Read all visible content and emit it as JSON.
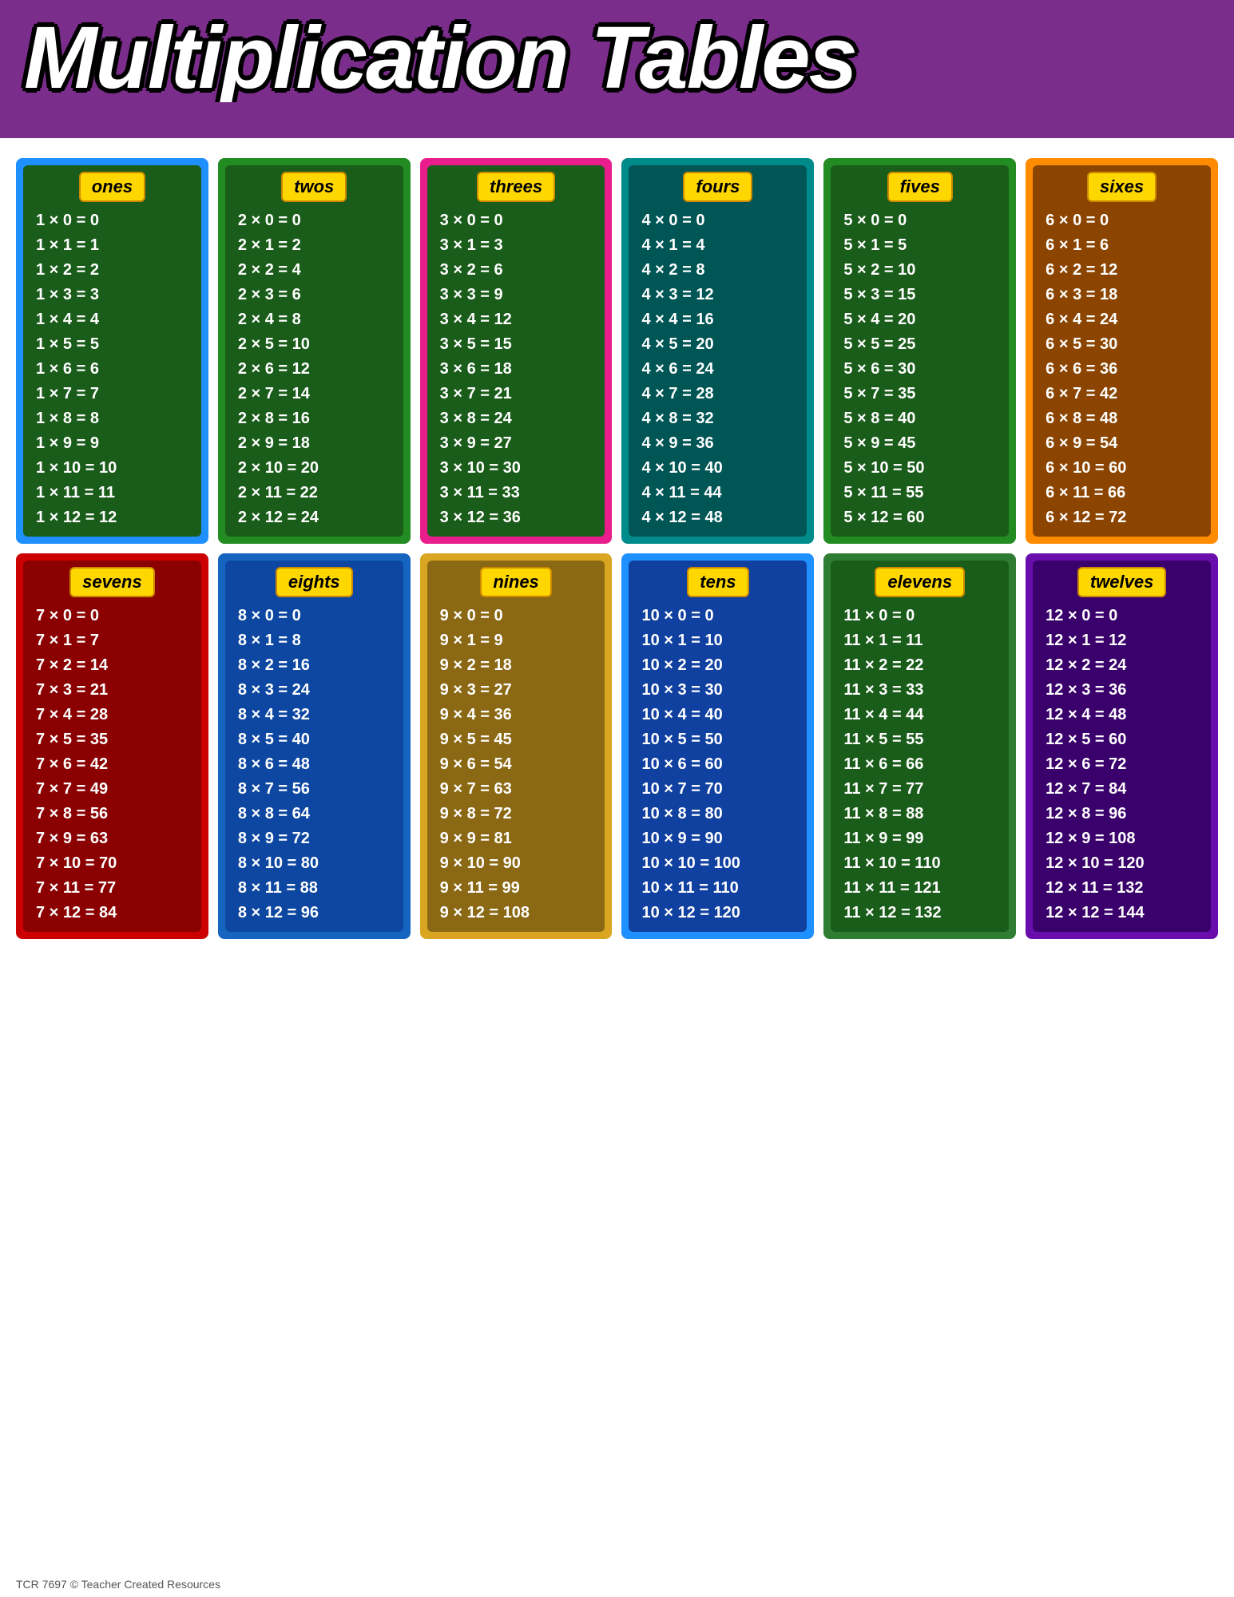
{
  "header": {
    "title": "Multiplication Tables",
    "background": "#7B2D8B"
  },
  "footer": {
    "text": "TCR 7697  © Teacher Created Resources"
  },
  "tables": [
    {
      "id": "ones",
      "label": "ones",
      "card_class": "card-blue",
      "inner_class": "inner-dark-green",
      "rows": [
        "1 x 0 = 0",
        "1 x 1 = 1",
        "1 x 2 = 2",
        "1 x 3 = 3",
        "1 x 4 = 4",
        "1 x 5 = 5",
        "1 x 6 = 6",
        "1 x 7 = 7",
        "1 x 8 = 8",
        "1 x 9 = 9",
        "1 x 10 = 10",
        "1 x 11 = 11",
        "1 x 12 = 12"
      ]
    },
    {
      "id": "twos",
      "label": "twos",
      "card_class": "card-green-border",
      "inner_class": "inner-dark-green2",
      "rows": [
        "2 x 0 = 0",
        "2 x 1 = 2",
        "2 x 2 = 4",
        "2 x 3 = 6",
        "2 x 4 = 8",
        "2 x 5 = 10",
        "2 x 6 = 12",
        "2 x 7 = 14",
        "2 x 8 = 16",
        "2 x 9 = 18",
        "2 x 10 = 20",
        "2 x 11 = 22",
        "2 x 12 = 24"
      ]
    },
    {
      "id": "threes",
      "label": "threes",
      "card_class": "card-pink",
      "inner_class": "inner-dark-green2",
      "rows": [
        "3 x 0 = 0",
        "3 x 1 = 3",
        "3 x 2 = 6",
        "3 x 3 = 9",
        "3 x 4 = 12",
        "3 x 5 = 15",
        "3 x 6 = 18",
        "3 x 7 = 21",
        "3 x 8 = 24",
        "3 x 9 = 27",
        "3 x 10 = 30",
        "3 x 11 = 33",
        "3 x 12 = 36"
      ]
    },
    {
      "id": "fours",
      "label": "fours",
      "card_class": "card-teal",
      "inner_class": "inner-dark-teal",
      "rows": [
        "4 x 0 = 0",
        "4 x 1 = 4",
        "4 x 2 = 8",
        "4 x 3 = 12",
        "4 x 4 = 16",
        "4 x 5 = 20",
        "4 x 6 = 24",
        "4 x 7 = 28",
        "4 x 8 = 32",
        "4 x 9 = 36",
        "4 x 10 = 40",
        "4 x 11 = 44",
        "4 x 12 = 48"
      ]
    },
    {
      "id": "fives",
      "label": "fives",
      "card_class": "card-green2",
      "inner_class": "inner-dark-green3",
      "rows": [
        "5 x 0 = 0",
        "5 x 1 = 5",
        "5 x 2 = 10",
        "5 x 3 = 15",
        "5 x 4 = 20",
        "5 x 5 = 25",
        "5 x 6 = 30",
        "5 x 7 = 35",
        "5 x 8 = 40",
        "5 x 9 = 45",
        "5 x 10 = 50",
        "5 x 11 = 55",
        "5 x 12 = 60"
      ]
    },
    {
      "id": "sixes",
      "label": "sixes",
      "card_class": "card-orange",
      "inner_class": "inner-dark-orange",
      "rows": [
        "6 x 0 = 0",
        "6 x 1 = 6",
        "6 x 2 = 12",
        "6 x 3 = 18",
        "6 x 4 = 24",
        "6 x 5 = 30",
        "6 x 6 = 36",
        "6 x 7 = 42",
        "6 x 8 = 48",
        "6 x 9 = 54",
        "6 x 10 = 60",
        "6 x 11 = 66",
        "6 x 12 = 72"
      ]
    },
    {
      "id": "sevens",
      "label": "sevens",
      "card_class": "card-red",
      "inner_class": "inner-dark-red",
      "rows": [
        "7 x 0 = 0",
        "7 x 1 = 7",
        "7 x 2 = 14",
        "7 x 3 = 21",
        "7 x 4 = 28",
        "7 x 5 = 35",
        "7 x 6 = 42",
        "7 x 7 = 49",
        "7 x 8 = 56",
        "7 x 9 = 63",
        "7 x 10 = 70",
        "7 x 11 = 77",
        "7 x 12 = 84"
      ]
    },
    {
      "id": "eights",
      "label": "eights",
      "card_class": "card-blue2",
      "inner_class": "inner-dark-blue",
      "rows": [
        "8 x 0 = 0",
        "8 x 1 = 8",
        "8 x 2 = 16",
        "8 x 3 = 24",
        "8 x 4 = 32",
        "8 x 5 = 40",
        "8 x 6 = 48",
        "8 x 7 = 56",
        "8 x 8 = 64",
        "8 x 9 = 72",
        "8 x 10 = 80",
        "8 x 11 = 88",
        "8 x 12 = 96"
      ]
    },
    {
      "id": "nines",
      "label": "nines",
      "card_class": "card-yellow-border",
      "inner_class": "inner-dark-gold",
      "rows": [
        "9 x 0 = 0",
        "9 x 1 = 9",
        "9 x 2 = 18",
        "9 x 3 = 27",
        "9 x 4 = 36",
        "9 x 5 = 45",
        "9 x 6 = 54",
        "9 x 7 = 63",
        "9 x 8 = 72",
        "9 x 9 = 81",
        "9 x 10 = 90",
        "9 x 11 = 99",
        "9 x 12 = 108"
      ]
    },
    {
      "id": "tens",
      "label": "tens",
      "card_class": "card-blue3",
      "inner_class": "inner-dark-blue2",
      "rows": [
        "10 x 0 = 0",
        "10 x 1 = 10",
        "10 x 2 = 20",
        "10 x 3 = 30",
        "10 x 4 = 40",
        "10 x 5 = 50",
        "10 x 6 = 60",
        "10 x 7 = 70",
        "10 x 8 = 80",
        "10 x 9 = 90",
        "10 x 10 = 100",
        "10 x 11 = 110",
        "10 x 12 = 120"
      ]
    },
    {
      "id": "elevens",
      "label": "elevens",
      "card_class": "card-green3",
      "inner_class": "inner-dark-green4",
      "rows": [
        "11 x 0 = 0",
        "11 x 1 = 11",
        "11 x 2 = 22",
        "11 x 3 = 33",
        "11 x 4 = 44",
        "11 x 5 = 55",
        "11 x 6 = 66",
        "11 x 7 = 77",
        "11 x 8 = 88",
        "11 x 9 = 99",
        "11 x 10 = 110",
        "11 x 11 = 121",
        "11 x 12 = 132"
      ]
    },
    {
      "id": "twelves",
      "label": "twelves",
      "card_class": "card-purple",
      "inner_class": "inner-dark-purple",
      "rows": [
        "12 x 0 = 0",
        "12 x 1 = 12",
        "12 x 2 = 24",
        "12 x 3 = 36",
        "12 x 4 = 48",
        "12 x 5 = 60",
        "12 x 6 = 72",
        "12 x 7 = 84",
        "12 x 8 = 96",
        "12 x 9 = 108",
        "12 x 10 = 120",
        "12 x 11 = 132",
        "12 x 12 = 144"
      ]
    }
  ]
}
